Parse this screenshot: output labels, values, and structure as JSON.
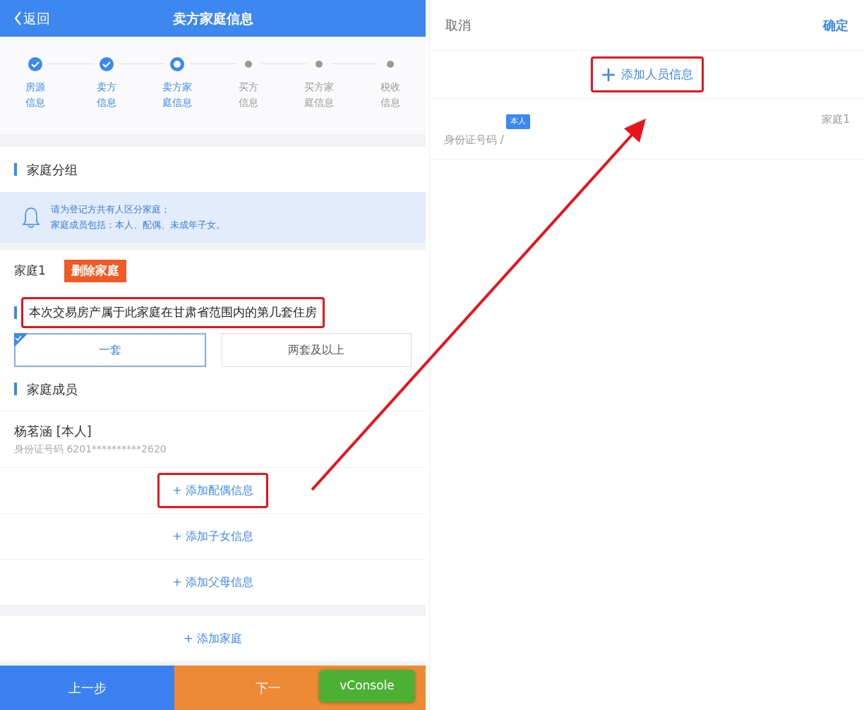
{
  "left_screen": {
    "header": {
      "back_label": "返回",
      "title": "卖方家庭信息"
    },
    "steps": [
      {
        "label": "房源信息",
        "kind": "done"
      },
      {
        "label": "卖方信息",
        "kind": "done"
      },
      {
        "label": "卖方家庭信息",
        "kind": "current"
      },
      {
        "label": "买方信息",
        "kind": "pending"
      },
      {
        "label": "买方家庭信息",
        "kind": "pending"
      },
      {
        "label": "税收信息",
        "kind": "pending"
      }
    ],
    "group_section": {
      "title": "家庭分组",
      "notice": [
        "请为登记方共有人区分家庭；",
        "家庭成员包括：本人、配偶、未成年子女。"
      ]
    },
    "families": [
      {
        "name": "家庭1",
        "delete_button": "删除家庭",
        "question": {
          "text": "本次交易房产属于此家庭在甘肃省范围内的第几套住房",
          "highlighted": true
        },
        "options": [
          {
            "label": "一套",
            "selected": true
          },
          {
            "label": "两套及以上",
            "selected": false
          }
        ],
        "members_title": "家庭成员",
        "members": [
          {
            "name": "杨茗涵 [本人]",
            "id_label": "身份证号码",
            "id_number": "6201**********2620"
          }
        ],
        "add_links": [
          {
            "label": "+ 添加配偶信息",
            "highlighted": true
          },
          {
            "label": "+ 添加子女信息",
            "highlighted": false
          },
          {
            "label": "+ 添加父母信息",
            "highlighted": false
          }
        ]
      }
    ],
    "add_family": "+ 添加家庭",
    "footer": [
      {
        "label": "上一步",
        "kind": "back"
      },
      {
        "label": "下一",
        "kind": "next"
      }
    ],
    "vconsole": "vConsole"
  },
  "right_screen": {
    "header": {
      "cancel": "取消",
      "confirm": "确定"
    },
    "add_person": {
      "label": "添加人员信息",
      "highlighted": true
    },
    "persons": [
      {
        "badge": "本人",
        "id_label": "身份证号码",
        "id_number": "/",
        "family": "家庭1"
      }
    ]
  },
  "annotation": {
    "arrow": true
  }
}
